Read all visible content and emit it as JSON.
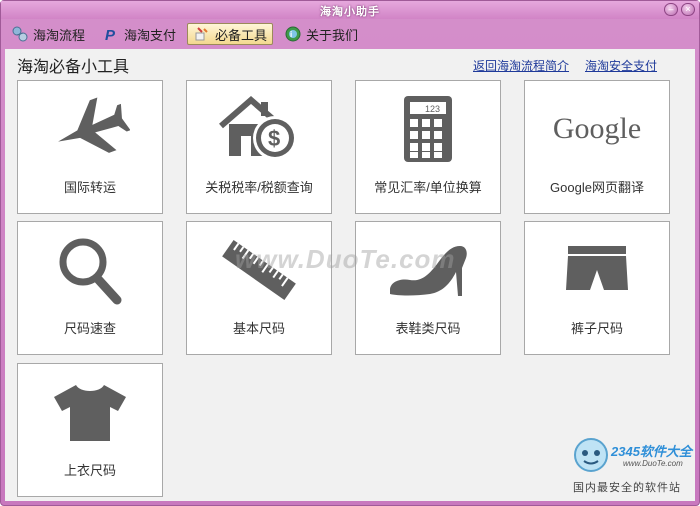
{
  "window": {
    "title": "海淘小助手"
  },
  "toolbar": {
    "items": [
      {
        "label": "海淘流程",
        "icon": "workflow-icon",
        "active": false
      },
      {
        "label": "海淘支付",
        "icon": "paypal-icon",
        "active": false
      },
      {
        "label": "必备工具",
        "icon": "tools-icon",
        "active": true
      },
      {
        "label": "关于我们",
        "icon": "globe-info-icon",
        "active": false
      }
    ]
  },
  "main": {
    "heading": "海淘必备小工具",
    "links": [
      "返回海淘流程简介",
      "海淘安全支付"
    ],
    "tiles": [
      {
        "label": "国际转运",
        "icon": "airplane-icon"
      },
      {
        "label": "关税税率/税额查询",
        "icon": "house-dollar-icon"
      },
      {
        "label": "常见汇率/单位换算",
        "icon": "calculator-icon",
        "display": "123"
      },
      {
        "label": "Google网页翻译",
        "icon": "google-logo",
        "logo_text": "Google"
      },
      {
        "label": "尺码速查",
        "icon": "magnifier-icon"
      },
      {
        "label": "基本尺码",
        "icon": "ruler-icon"
      },
      {
        "label": "表鞋类尺码",
        "icon": "high-heel-icon"
      },
      {
        "label": "裤子尺码",
        "icon": "shorts-icon"
      },
      {
        "label": "上衣尺码",
        "icon": "tshirt-icon"
      }
    ]
  },
  "overlay": {
    "watermark": "www.DuoTe.com",
    "badge_title": "2345软件大全",
    "badge_url": "www.DuoTe.com",
    "badge_sub": "国内最安全的软件站"
  },
  "colors": {
    "frame": "#c878be",
    "link": "#1f3a9a",
    "icon": "#5f5f5f",
    "active_tab": "#f3d88e"
  }
}
